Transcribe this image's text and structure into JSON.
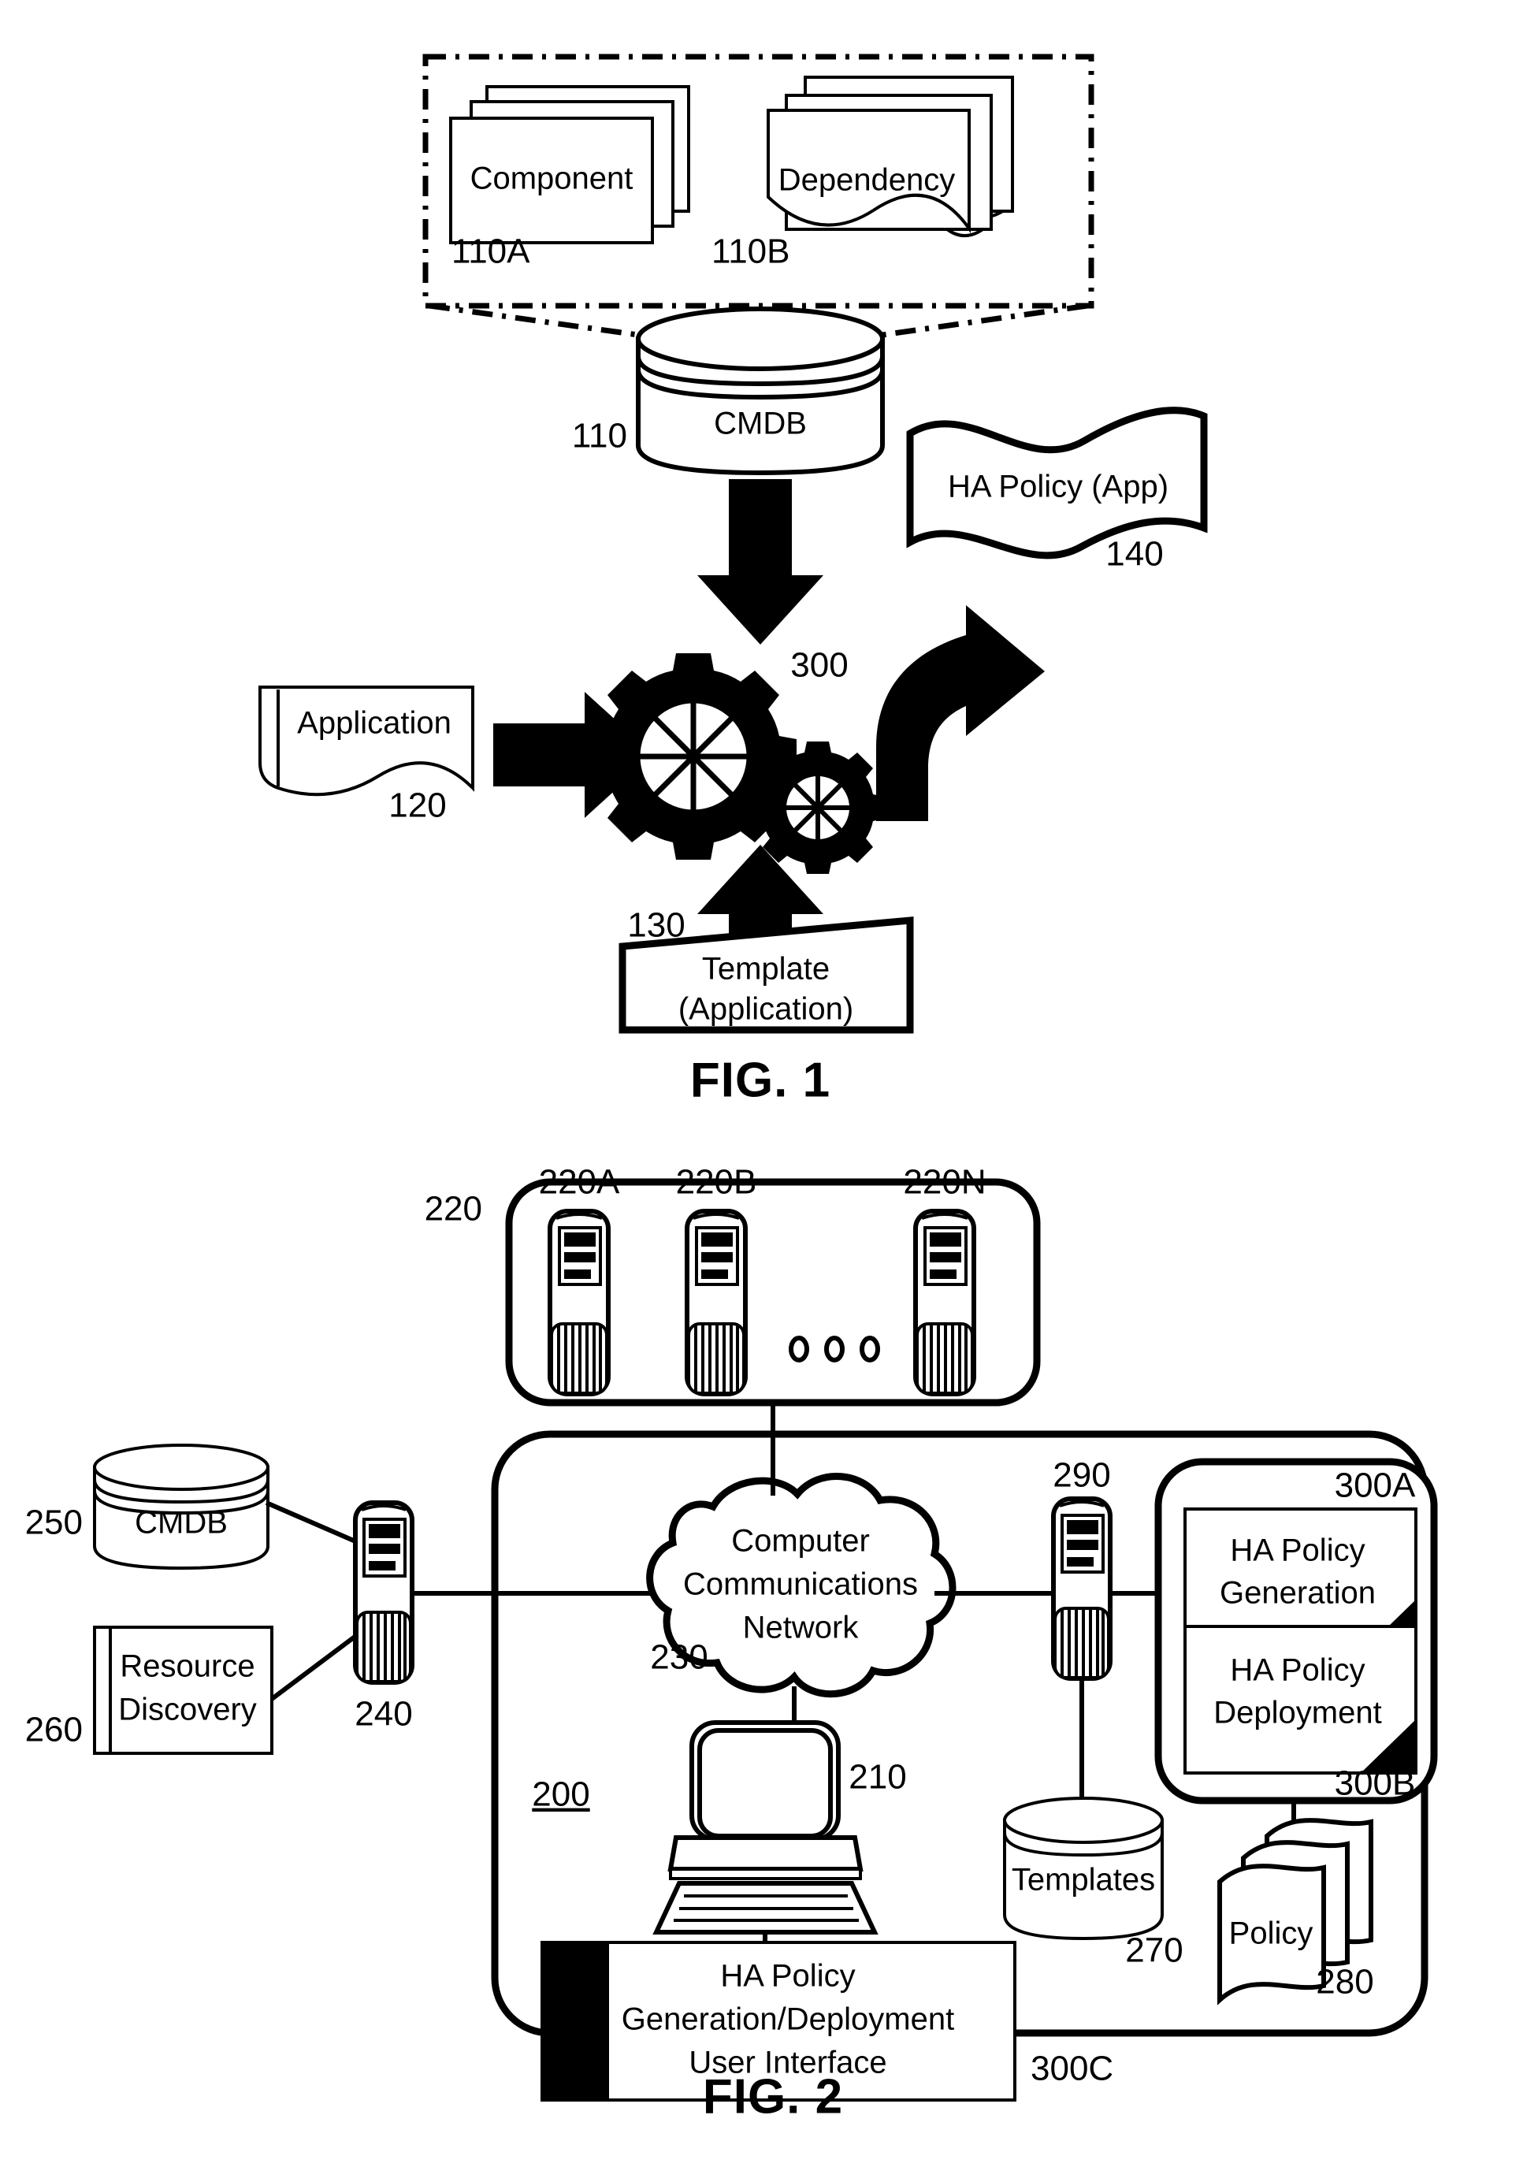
{
  "figures": [
    {
      "id": "fig1",
      "title": "FIG. 1",
      "nodes": {
        "component": {
          "label": "Component",
          "ref": "110A"
        },
        "dependency": {
          "label": "Dependency",
          "ref": "110B"
        },
        "cmdb": {
          "label": "CMDB",
          "ref": "110"
        },
        "application": {
          "label": "Application",
          "ref": "120"
        },
        "template": {
          "label_line1": "Template",
          "label_line2": "(Application)",
          "ref": "130"
        },
        "ha_policy_app": {
          "label": "HA Policy (App)",
          "ref": "140"
        },
        "gears": {
          "ref": "300"
        }
      }
    },
    {
      "id": "fig2",
      "title": "FIG. 2",
      "nodes": {
        "host_group": {
          "ref": "220",
          "hosts": [
            "220A",
            "220B",
            "220N"
          ],
          "ellipsis": "○ ○ ○"
        },
        "cmdb": {
          "label": "CMDB",
          "ref": "250"
        },
        "resource_discovery": {
          "label_line1": "Resource",
          "label_line2": "Discovery",
          "ref": "260"
        },
        "data_server": {
          "ref": "240"
        },
        "network": {
          "label_line1": "Computer",
          "label_line2": "Communications",
          "label_line3": "Network",
          "ref": "230"
        },
        "workstation": {
          "ref": "210"
        },
        "ui_box": {
          "label_line1": "HA Policy",
          "label_line2": "Generation/Deployment",
          "label_line3": "User Interface",
          "ref": "300C"
        },
        "templates": {
          "label": "Templates",
          "ref": "270"
        },
        "policy_server": {
          "ref": "290"
        },
        "ha_policy_generation": {
          "label_line1": "HA Policy",
          "label_line2": "Generation",
          "ref": "300A"
        },
        "ha_policy_deployment": {
          "label_line1": "HA Policy",
          "label_line2": "Deployment",
          "ref": "300B"
        },
        "policy": {
          "label": "Policy",
          "ref": "280"
        },
        "system": {
          "ref": "200"
        }
      }
    }
  ],
  "colors": {
    "ink": "#000000",
    "paper": "#ffffff"
  }
}
